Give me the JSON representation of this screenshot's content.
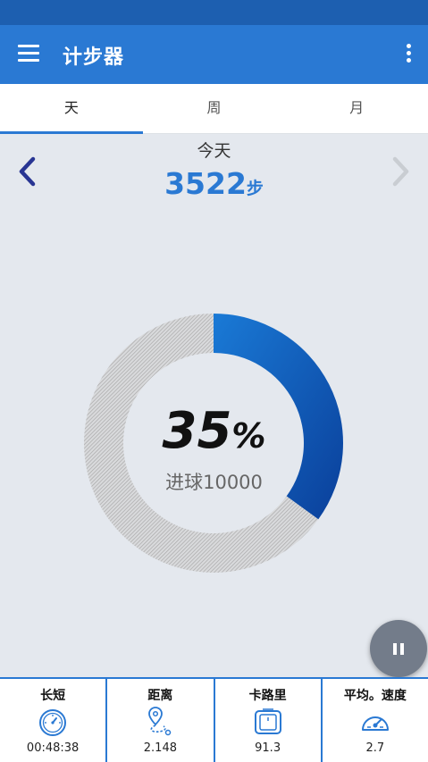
{
  "app": {
    "title": "计步器"
  },
  "tabs": [
    {
      "label": "天",
      "active": true
    },
    {
      "label": "周",
      "active": false
    },
    {
      "label": "月",
      "active": false
    }
  ],
  "day": {
    "label": "今天",
    "steps": "3522",
    "steps_unit": "步"
  },
  "progress": {
    "percent_value": "35",
    "percent_sign": "%",
    "fraction": 0.35,
    "goal_text": "进球10000"
  },
  "stats": [
    {
      "label": "长短",
      "icon": "stopwatch-icon",
      "value": "00:48:38"
    },
    {
      "label": "距离",
      "icon": "route-icon",
      "value": "2.148"
    },
    {
      "label": "卡路里",
      "icon": "scale-icon",
      "value": "91.3"
    },
    {
      "label": "平均。速度",
      "icon": "speedometer-icon",
      "value": "2.7"
    }
  ],
  "colors": {
    "accent": "#2a79d3",
    "status_bar": "#1d5fb0",
    "ring_start": "#1a7ad6",
    "ring_end": "#0a3f9a",
    "ring_track": "#b5b5b5",
    "prev_arrow": "#283593",
    "next_arrow_disabled": "#c9cdd2"
  }
}
